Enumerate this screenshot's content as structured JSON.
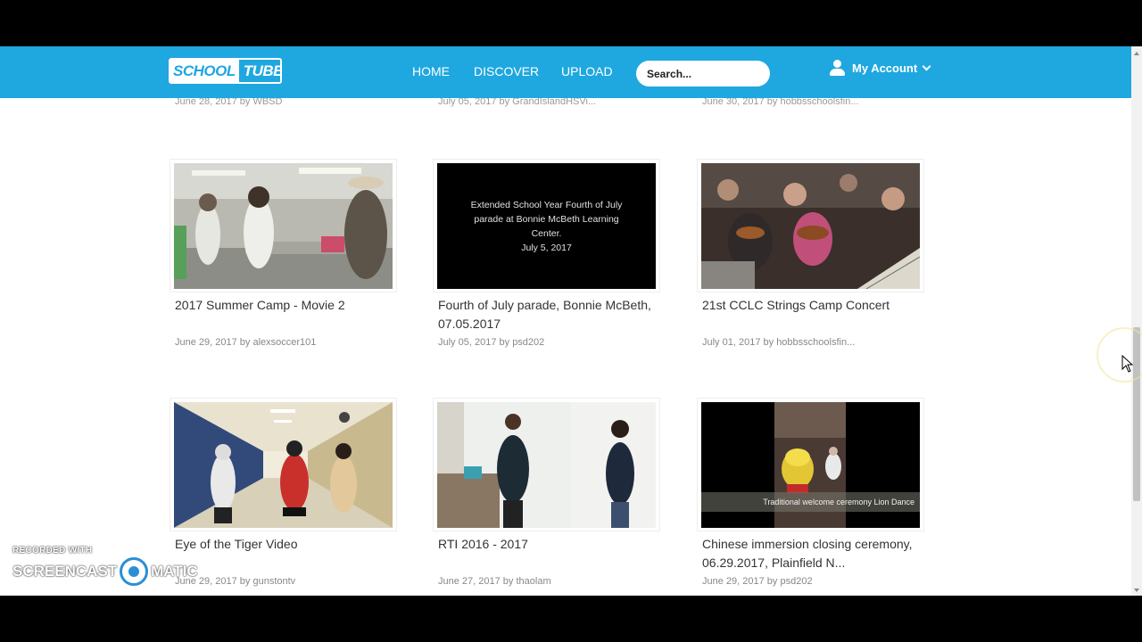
{
  "nav": {
    "logo_part1": "SCHOOL",
    "logo_part2": "TUBE",
    "home": "HOME",
    "discover": "DISCOVER",
    "upload": "UPLOAD",
    "search_placeholder": "Search...",
    "account": "My Account"
  },
  "previous_row_meta": [
    "June 28, 2017 by WBSD",
    "July 05, 2017 by GrandIslandHSVi...",
    "June 30, 2017 by hobbsschoolsfin..."
  ],
  "videos": [
    {
      "title": "2017 Summer Camp - Movie 2",
      "date": "June 29, 2017",
      "by": "by",
      "user": "alexsoccer101"
    },
    {
      "title": "Fourth of July parade, Bonnie McBeth, 07.05.2017",
      "date": "July 05, 2017",
      "by": "by",
      "user": "psd202",
      "thumb_text": [
        "Extended School Year Fourth of July",
        "parade at Bonnie McBeth Learning",
        "Center.",
        "July 5, 2017"
      ]
    },
    {
      "title": "21st CCLC Strings Camp Concert",
      "date": "July 01, 2017",
      "by": "by",
      "user": "hobbsschoolsfin..."
    },
    {
      "title": "Eye of the Tiger Video",
      "date": "June 29, 2017",
      "by": "by",
      "user": "gunstontv"
    },
    {
      "title": "RTI 2016 - 2017",
      "date": "June 27, 2017",
      "by": "by",
      "user": "thaolam"
    },
    {
      "title": "Chinese immersion closing ceremony, 06.29.2017, Plainfield N...",
      "date": "June 29, 2017",
      "by": "by",
      "user": "psd202",
      "thumb_caption": "Traditional welcome ceremony Lion Dance"
    }
  ],
  "watermark": {
    "recorded": "RECORDED WITH",
    "brand_left": "SCREENCAST",
    "brand_right": "MATIC"
  },
  "colors": {
    "navbar": "#1fa7e0",
    "text": "#333333",
    "meta": "#888888"
  }
}
